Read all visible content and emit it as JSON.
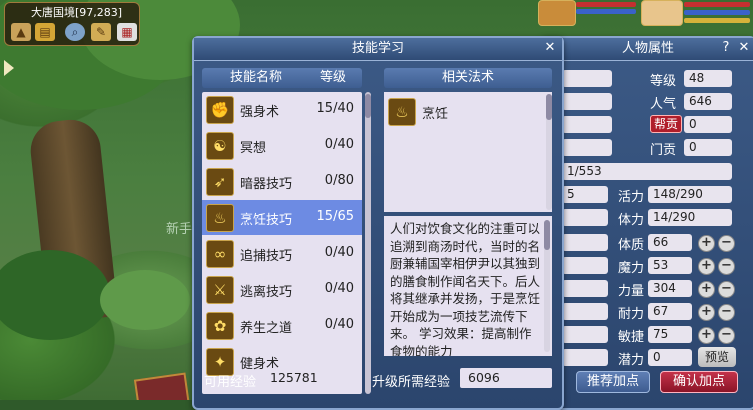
{
  "location": {
    "name": "大唐国境",
    "coords": "[97,283]"
  },
  "scene": {
    "npc_text": "新手"
  },
  "skill_window": {
    "title": "技能学习",
    "col_name": "技能名称",
    "col_level": "等级",
    "related_header": "相关法术",
    "related": [
      {
        "name": "烹饪",
        "icon": "cooking-icon"
      }
    ],
    "skills": [
      {
        "name": "强身术",
        "level": "15/40",
        "icon": "strength-icon"
      },
      {
        "name": "冥想",
        "level": "0/40",
        "icon": "meditate-icon"
      },
      {
        "name": "暗器技巧",
        "level": "0/80",
        "icon": "dart-icon"
      },
      {
        "name": "烹饪技巧",
        "level": "15/65",
        "icon": "cooking-icon",
        "selected": true
      },
      {
        "name": "追捕技巧",
        "level": "0/40",
        "icon": "chase-icon"
      },
      {
        "name": "逃离技巧",
        "level": "0/40",
        "icon": "escape-icon"
      },
      {
        "name": "养生之道",
        "level": "0/40",
        "icon": "health-icon"
      },
      {
        "name": "健身术",
        "level": "",
        "icon": "fitness-icon"
      }
    ],
    "description": "人们对饮食文化的注重可以追溯到商汤时代，当时的名厨兼辅国宰相伊尹以其独到的膳食制作闻名天下。后人将其继承并发扬，于是烹饪开始成为一项技艺流传下来。",
    "description_effect": "学习效果：提高制作食物的能力",
    "available_exp_label": "可用经验",
    "available_exp": "125781",
    "upgrade_exp_label": "升级所需经验",
    "upgrade_exp": "6096"
  },
  "attr_window": {
    "title": "人物属性",
    "help": "?",
    "level_label": "等级",
    "level": "48",
    "popularity_label": "人气",
    "popularity": "646",
    "gang_label": "帮贡",
    "gang": "0",
    "sect_label": "门贡",
    "sect": "0",
    "exp_partial": "1/553",
    "vitality_partial": "5",
    "vitality_label": "活力",
    "vitality": "148/290",
    "stamina_label": "体力",
    "stamina": "14/290",
    "stats": [
      {
        "label": "体质",
        "value": "66"
      },
      {
        "label": "魔力",
        "value": "53"
      },
      {
        "label": "力量",
        "value": "304"
      },
      {
        "label": "耐力",
        "value": "67"
      },
      {
        "label": "敏捷",
        "value": "75"
      }
    ],
    "potential_label": "潜力",
    "potential": "0",
    "preview_button": "预览",
    "recommend_button": "推荐加点",
    "confirm_button": "确认加点",
    "plus": "+"
  }
}
